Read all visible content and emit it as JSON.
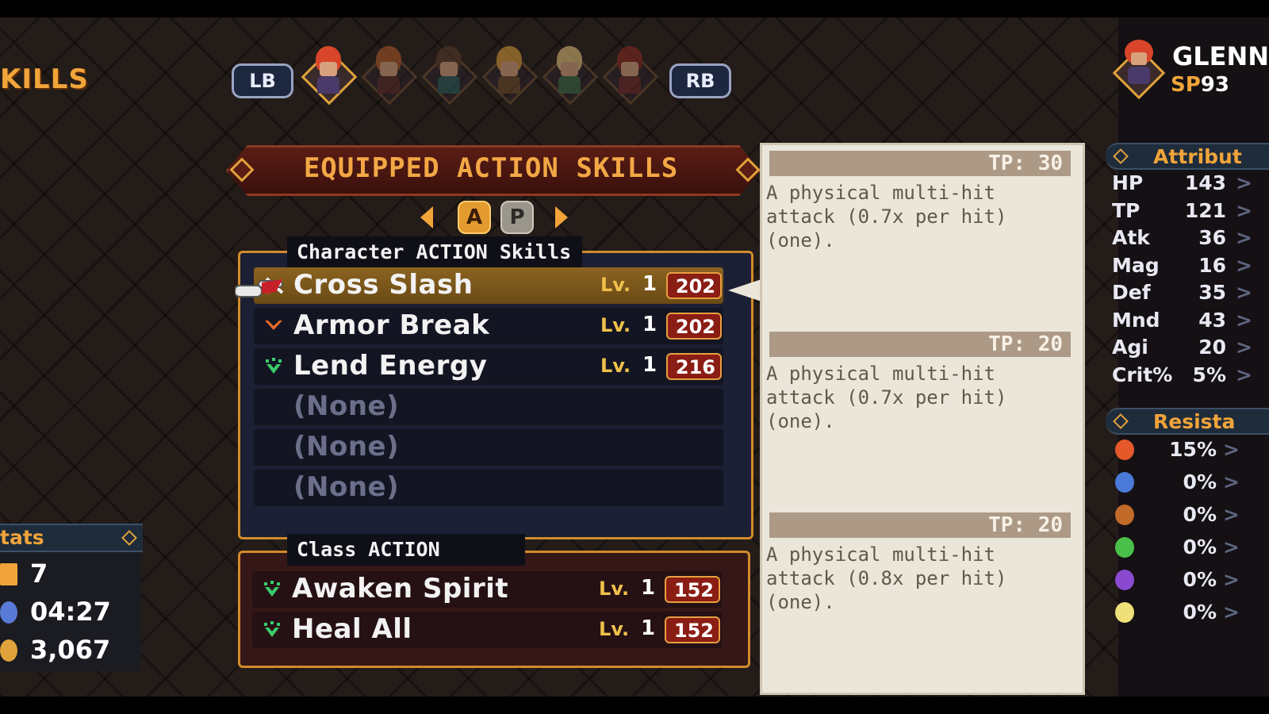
{
  "screen_title": "KILLS",
  "party": {
    "prev_button": "LB",
    "next_button": "RB",
    "members": [
      {
        "hair": "#d8452a",
        "outfit": "#4a3a6a",
        "active": true
      },
      {
        "hair": "#b35a2a",
        "outfit": "#5a2a2a",
        "active": false
      },
      {
        "hair": "#5a3a28",
        "outfit": "#2a5a5a",
        "active": false
      },
      {
        "hair": "#d99a3a",
        "outfit": "#6a4a2a",
        "active": false
      },
      {
        "hair": "#e0c07a",
        "outfit": "#3a6a4a",
        "active": false
      },
      {
        "hair": "#8a2a22",
        "outfit": "#6a2a2a",
        "active": false
      }
    ]
  },
  "equipped_header": "EQUIPPED ACTION SKILLS",
  "skill_tabs": {
    "active": "A",
    "inactive": "P"
  },
  "character_section": {
    "label": "Character ACTION Skills",
    "skills": [
      {
        "name": "Cross Slash",
        "lv_label": "Lv.",
        "level": "1",
        "cost": "202",
        "icon": "sword-slash-icon",
        "selected": true
      },
      {
        "name": "Armor Break",
        "lv_label": "Lv.",
        "level": "1",
        "cost": "202",
        "icon": "armor-break-icon",
        "selected": false
      },
      {
        "name": "Lend Energy",
        "lv_label": "Lv.",
        "level": "1",
        "cost": "216",
        "icon": "support-icon",
        "selected": false
      },
      {
        "name": "(None)",
        "empty": true
      },
      {
        "name": "(None)",
        "empty": true
      },
      {
        "name": "(None)",
        "empty": true
      }
    ]
  },
  "class_section": {
    "label": "Class ACTION Skills",
    "skills": [
      {
        "name": "Awaken Spirit",
        "lv_label": "Lv.",
        "level": "1",
        "cost": "152",
        "icon": "support-icon"
      },
      {
        "name": "Heal All",
        "lv_label": "Lv.",
        "level": "1",
        "cost": "152",
        "icon": "support-icon"
      }
    ]
  },
  "descriptions": [
    {
      "tp": "TP: 30",
      "text": "A physical multi-hit\nattack (0.7x per hit)\n(one)."
    },
    {
      "tp": "TP: 20",
      "text": "A physical multi-hit\nattack (0.7x per hit)\n(one)."
    },
    {
      "tp": "TP: 20",
      "text": "A physical multi-hit\nattack (0.8x per hit)\n(one)."
    }
  ],
  "character": {
    "name": "GLENN",
    "sp_label": "SP",
    "sp_value": "93"
  },
  "attributes": {
    "header": "Attribut",
    "rows": [
      {
        "key": "HP",
        "value": "143"
      },
      {
        "key": "TP",
        "value": "121"
      },
      {
        "key": "Atk",
        "value": "36"
      },
      {
        "key": "Mag",
        "value": "16"
      },
      {
        "key": "Def",
        "value": "35"
      },
      {
        "key": "Mnd",
        "value": "43"
      },
      {
        "key": "Agi",
        "value": "20"
      },
      {
        "key": "Crit%",
        "value": "5%"
      }
    ]
  },
  "resistances": {
    "header": "Resista",
    "rows": [
      {
        "element": "fire-icon",
        "color": "#e4582a",
        "value": "15%"
      },
      {
        "element": "water-icon",
        "color": "#4a7ad8",
        "value": "0%"
      },
      {
        "element": "earth-icon",
        "color": "#c26a2a",
        "value": "0%"
      },
      {
        "element": "wind-icon",
        "color": "#4ac04a",
        "value": "0%"
      },
      {
        "element": "dark-icon",
        "color": "#8a4ad0",
        "value": "0%"
      },
      {
        "element": "light-icon",
        "color": "#f0e07a",
        "value": "0%"
      }
    ]
  },
  "stats": {
    "header": "tats",
    "rows": [
      {
        "icon": "star-icon",
        "color": "#f0a43a",
        "value": "7"
      },
      {
        "icon": "clock-icon",
        "color": "#5a7ad8",
        "value": "04:27"
      },
      {
        "icon": "coin-icon",
        "color": "#e0a23a",
        "value": "3,067"
      }
    ]
  },
  "chevron": ">"
}
